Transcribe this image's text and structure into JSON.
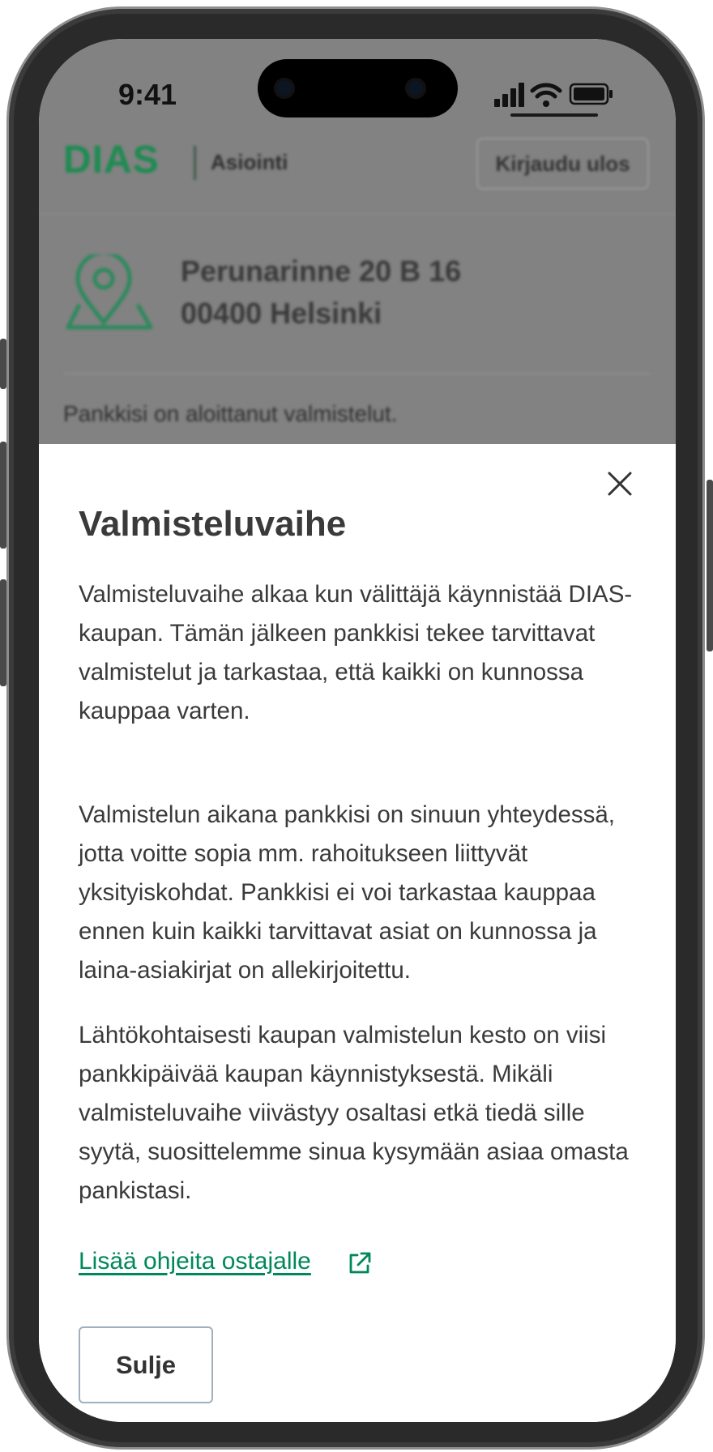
{
  "status_bar": {
    "time": "9:41"
  },
  "header": {
    "brand": "DIAS",
    "subtitle": "Asiointi",
    "logout_label": "Kirjaudu ulos"
  },
  "property": {
    "address_line1": "Perunarinne 20 B 16",
    "address_line2": "00400 Helsinki",
    "status_text": "Pankkisi on aloittanut valmistelut."
  },
  "modal": {
    "title": "Valmisteluvaihe",
    "paragraphs": [
      "Valmisteluvaihe alkaa kun välittäjä käynnistää DIAS-kaupan. Tämän jälkeen pankkisi tekee tarvittavat valmistelut ja tarkastaa, että kaikki on kunnossa kauppaa varten.",
      "Valmistelun aikana pankkisi on sinuun yhteydessä, jotta voitte sopia mm. rahoitukseen liittyvät yksityiskohdat. Pankkisi ei voi tarkastaa kauppaa ennen kuin kaikki tarvittavat asiat on kunnossa ja laina-asiakirjat on allekirjoitettu.",
      "Lähtökohtaisesti kaupan valmistelun kesto on viisi pankkipäivää kaupan käynnistyksestä. Mikäli valmisteluvaihe viivästyy osaltasi etkä tiedä sille syytä, suosittelemme sinua kysymään asiaa omasta pankistasi."
    ],
    "link_label": "Lisää ohjeita ostajalle",
    "close_button_label": "Sulje"
  },
  "icons": {
    "close": "close-icon",
    "external_link": "external-link-icon",
    "location_pin": "location-pin-icon",
    "signal": "signal-icon",
    "wifi": "wifi-icon",
    "battery": "battery-icon"
  },
  "colors": {
    "brand_green": "#1e8b52",
    "link_green": "#00885c",
    "overlay": "#828282",
    "text": "#3a3a3a"
  }
}
